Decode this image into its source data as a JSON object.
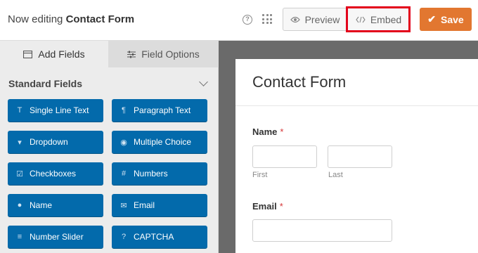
{
  "header": {
    "title_prefix": "Now editing",
    "title_form": "Contact Form",
    "help_icon": "question-circle-icon",
    "grid_icon": "apps-grid-icon",
    "preview_label": "Preview",
    "embed_label": "Embed",
    "save_label": "Save",
    "save_color": "#e27730",
    "highlight_color": "#e3001b"
  },
  "sidebar": {
    "tabs": [
      {
        "label": "Add Fields",
        "icon": "list-icon"
      },
      {
        "label": "Field Options",
        "icon": "sliders-icon"
      }
    ],
    "section_title": "Standard Fields",
    "button_color": "#036aab",
    "fields": [
      {
        "label": "Single Line Text",
        "icon": "text-icon",
        "glyph": "T"
      },
      {
        "label": "Paragraph Text",
        "icon": "paragraph-icon",
        "glyph": "¶"
      },
      {
        "label": "Dropdown",
        "icon": "dropdown-icon",
        "glyph": "▾"
      },
      {
        "label": "Multiple Choice",
        "icon": "radio-icon",
        "glyph": "◉"
      },
      {
        "label": "Checkboxes",
        "icon": "checkbox-icon",
        "glyph": "☑"
      },
      {
        "label": "Numbers",
        "icon": "hash-icon",
        "glyph": "#"
      },
      {
        "label": "Name",
        "icon": "user-icon",
        "glyph": "●"
      },
      {
        "label": "Email",
        "icon": "envelope-icon",
        "glyph": "✉"
      },
      {
        "label": "Number Slider",
        "icon": "slider-icon",
        "glyph": "≡"
      },
      {
        "label": "CAPTCHA",
        "icon": "question-icon",
        "glyph": "?"
      }
    ]
  },
  "preview": {
    "form_title": "Contact Form",
    "name_label": "Name",
    "required_mark": "*",
    "first_label": "First",
    "last_label": "Last",
    "email_label": "Email"
  }
}
